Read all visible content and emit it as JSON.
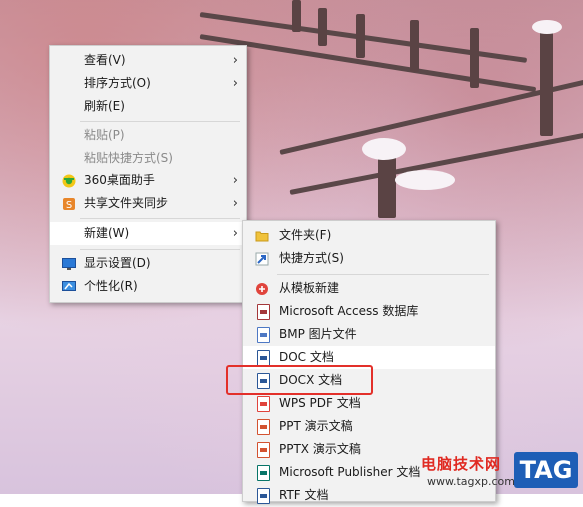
{
  "context_menu": {
    "items": [
      {
        "label": "查看(V)",
        "has_submenu": true,
        "enabled": true
      },
      {
        "label": "排序方式(O)",
        "has_submenu": true,
        "enabled": true
      },
      {
        "label": "刷新(E)",
        "has_submenu": false,
        "enabled": true
      },
      {
        "label": "粘贴(P)",
        "has_submenu": false,
        "enabled": false
      },
      {
        "label": "粘贴快捷方式(S)",
        "has_submenu": false,
        "enabled": false
      },
      {
        "label": "360桌面助手",
        "has_submenu": true,
        "enabled": true,
        "icon": "360-assistant-icon"
      },
      {
        "label": "共享文件夹同步",
        "has_submenu": true,
        "enabled": true,
        "icon": "shared-folder-sync-icon"
      },
      {
        "label": "新建(W)",
        "has_submenu": true,
        "enabled": true,
        "highlighted": true
      },
      {
        "label": "显示设置(D)",
        "has_submenu": false,
        "enabled": true,
        "icon": "display-settings-icon"
      },
      {
        "label": "个性化(R)",
        "has_submenu": false,
        "enabled": true,
        "icon": "personalize-icon"
      }
    ],
    "arrow": "›"
  },
  "new_submenu": {
    "items": [
      {
        "label": "文件夹(F)",
        "icon": "folder-icon",
        "color": "#f0c23b"
      },
      {
        "label": "快捷方式(S)",
        "icon": "shortcut-icon",
        "color": "#2a66c4"
      },
      {
        "label": "从模板新建",
        "icon": "template-icon",
        "color": "#e0443c"
      },
      {
        "label": "Microsoft Access 数据库",
        "icon": "access-icon",
        "color": "#a4373a"
      },
      {
        "label": "BMP 图片文件",
        "icon": "bmp-icon",
        "color": "#4d78c4"
      },
      {
        "label": "DOC 文档",
        "icon": "doc-icon",
        "color": "#2b5797",
        "highlighted": true
      },
      {
        "label": "DOCX 文档",
        "icon": "docx-icon",
        "color": "#2b5797",
        "boxed": true
      },
      {
        "label": "WPS PDF 文档",
        "icon": "pdf-icon",
        "color": "#e0443c"
      },
      {
        "label": "PPT 演示文稿",
        "icon": "ppt-icon",
        "color": "#d35230"
      },
      {
        "label": "PPTX 演示文稿",
        "icon": "pptx-icon",
        "color": "#d35230"
      },
      {
        "label": "Microsoft Publisher 文档",
        "icon": "publisher-icon",
        "color": "#077568"
      },
      {
        "label": "RTF 文档",
        "icon": "rtf-icon",
        "color": "#2b5797"
      }
    ]
  },
  "watermark": {
    "site_name": "电脑技术网",
    "url": "www.tagxp.com",
    "tag": "TAG"
  },
  "colors": {
    "highlight_box": "#e3302a",
    "menu_bg": "#f2f2f2"
  }
}
